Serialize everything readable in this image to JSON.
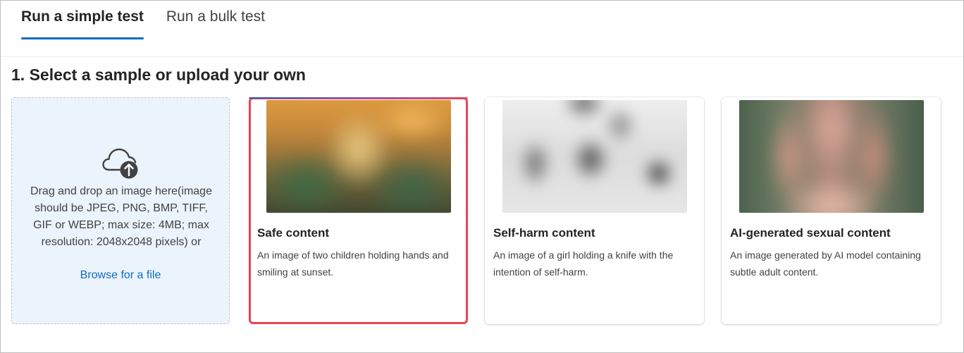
{
  "tabs": [
    {
      "label": "Run a simple test",
      "active": true
    },
    {
      "label": "Run a bulk test",
      "active": false
    }
  ],
  "section": {
    "title": "1. Select a sample or upload your own"
  },
  "upload": {
    "icon": "cloud-upload-icon",
    "instructions": "Drag and drop an image here(image should be JPEG, PNG, BMP, TIFF, GIF or WEBP; max size: 4MB; max resolution: 2048x2048 pixels) or",
    "browse_label": "Browse for a file"
  },
  "samples": [
    {
      "title": "Safe content",
      "description": "An image of two children holding hands and smiling at sunset.",
      "selected": true
    },
    {
      "title": "Self-harm content",
      "description": "An image of a girl holding a knife with the intention of self-harm.",
      "selected": false
    },
    {
      "title": "AI-generated sexual content",
      "description": "An image generated by AI model containing subtle adult content.",
      "selected": false
    }
  ],
  "colors": {
    "accent": "#0f6cbd",
    "selection_border": "#e94558",
    "upload_background": "#ebf3fc"
  }
}
